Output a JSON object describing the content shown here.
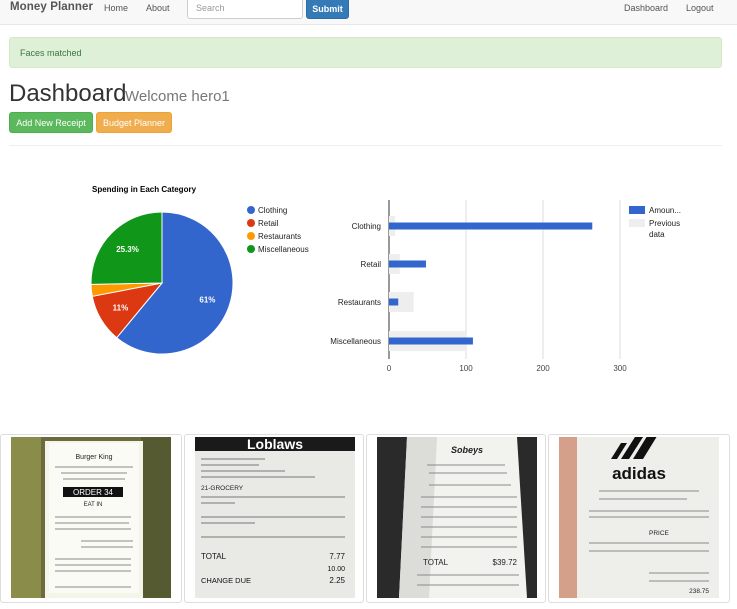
{
  "navbar": {
    "brand": "Money Planner",
    "links": {
      "home": "Home",
      "about": "About",
      "dashboard": "Dashboard",
      "logout": "Logout"
    },
    "search_placeholder": "Search",
    "submit_label": "Submit"
  },
  "alert": {
    "text": "Faces matched"
  },
  "header": {
    "title": "Dashboard",
    "subtitle": "Welcome hero1"
  },
  "actions": {
    "add_receipt": "Add New Receipt",
    "budget_planner": "Budget Planner"
  },
  "chart_data": [
    {
      "type": "pie",
      "title": "Spending in Each Category",
      "categories": [
        "Clothing",
        "Retail",
        "Restaurants",
        "Miscellaneous"
      ],
      "values": [
        61,
        11,
        2.7,
        25.3
      ],
      "slice_labels": [
        "61%",
        "11%",
        "",
        "25.3%"
      ],
      "colors": [
        "#3366cc",
        "#dc3912",
        "#ff9900",
        "#109618"
      ],
      "legend": "right"
    },
    {
      "type": "bar",
      "orientation": "horizontal",
      "categories": [
        "Clothing",
        "Retail",
        "Restaurants",
        "Miscellaneous"
      ],
      "series": [
        {
          "name": "Amoun...",
          "values": [
            264,
            48,
            12,
            109
          ],
          "color": "#3366cc"
        },
        {
          "name": "Previous data",
          "values": [
            8,
            14,
            32,
            100
          ],
          "color": "#eeeeee"
        }
      ],
      "xticks": [
        0,
        100,
        200,
        300
      ],
      "xlim": [
        0,
        300
      ],
      "grid": true,
      "legend": "right"
    }
  ],
  "receipts": [
    {
      "store": "Burger King",
      "order": "ORDER 34",
      "mode": "EAT IN"
    },
    {
      "store": "Loblaws",
      "dept": "21-GROCERY",
      "total_label": "TOTAL",
      "total": "7.77",
      "cash": "10.00",
      "change_label": "CHANGE DUE",
      "change": "2.25"
    },
    {
      "store": "Sobeys",
      "total_label": "TOTAL",
      "total": "$39.72"
    },
    {
      "store": "adidas",
      "line": "PRICE",
      "total": "238.75"
    }
  ]
}
